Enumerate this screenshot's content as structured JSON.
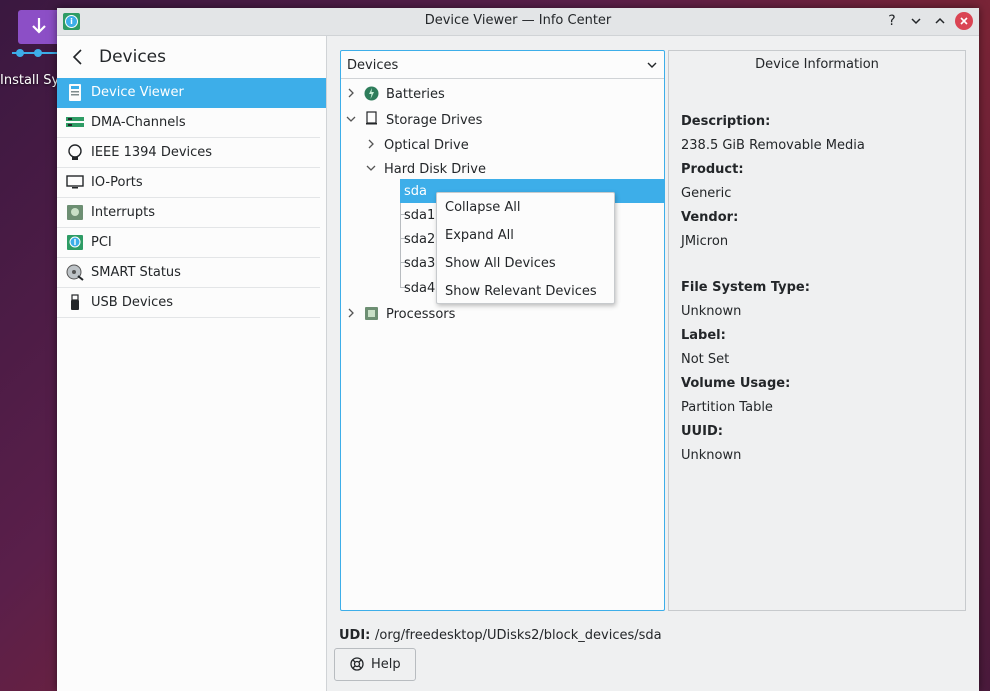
{
  "desktop": {
    "icon_label": "Install Sys"
  },
  "window": {
    "title": "Device Viewer — Info Center"
  },
  "titlebar_buttons": {
    "help": "?",
    "minimize": "⌄",
    "maximize": "⌃",
    "close": "×"
  },
  "sidebar": {
    "title": "Devices",
    "items": [
      {
        "label": "Device Viewer",
        "icon": "info-device-icon",
        "active": true
      },
      {
        "label": "DMA-Channels",
        "icon": "dma-card-icon"
      },
      {
        "label": "IEEE 1394 Devices",
        "icon": "firewire-icon"
      },
      {
        "label": "IO-Ports",
        "icon": "monitor-icon"
      },
      {
        "label": "Interrupts",
        "icon": "interrupt-icon"
      },
      {
        "label": "PCI",
        "icon": "pci-icon"
      },
      {
        "label": "SMART Status",
        "icon": "smart-disk-icon"
      },
      {
        "label": "USB Devices",
        "icon": "usb-icon"
      }
    ]
  },
  "tree": {
    "header": "Devices",
    "rows": {
      "batteries": "Batteries",
      "storage": "Storage Drives",
      "optical": "Optical Drive",
      "hdd": "Hard Disk Drive",
      "sda": "sda",
      "sda1": "sda1",
      "sda2": "sda2",
      "sda3": "sda3",
      "sda4": "sda4",
      "processors": "Processors"
    }
  },
  "context_menu": {
    "items": [
      "Collapse All",
      "Expand All",
      "Show All Devices",
      "Show Relevant Devices"
    ]
  },
  "info": {
    "title": "Device Information",
    "description_label": "Description:",
    "description": "238.5 GiB Removable Media",
    "product_label": "Product:",
    "product": "Generic",
    "vendor_label": "Vendor:",
    "vendor": "JMicron",
    "fs_label": "File System Type:",
    "fs": "Unknown",
    "label_label": "Label:",
    "label": "Not Set",
    "usage_label": "Volume Usage:",
    "usage": "Partition Table",
    "uuid_label": "UUID:",
    "uuid": "Unknown"
  },
  "udi": {
    "label": "UDI:",
    "value": "/org/freedesktop/UDisks2/block_devices/sda"
  },
  "help_button": {
    "label": "Help"
  },
  "colors": {
    "accent": "#3daee9",
    "close": "#da4453",
    "window_bg": "#eff0f1"
  }
}
